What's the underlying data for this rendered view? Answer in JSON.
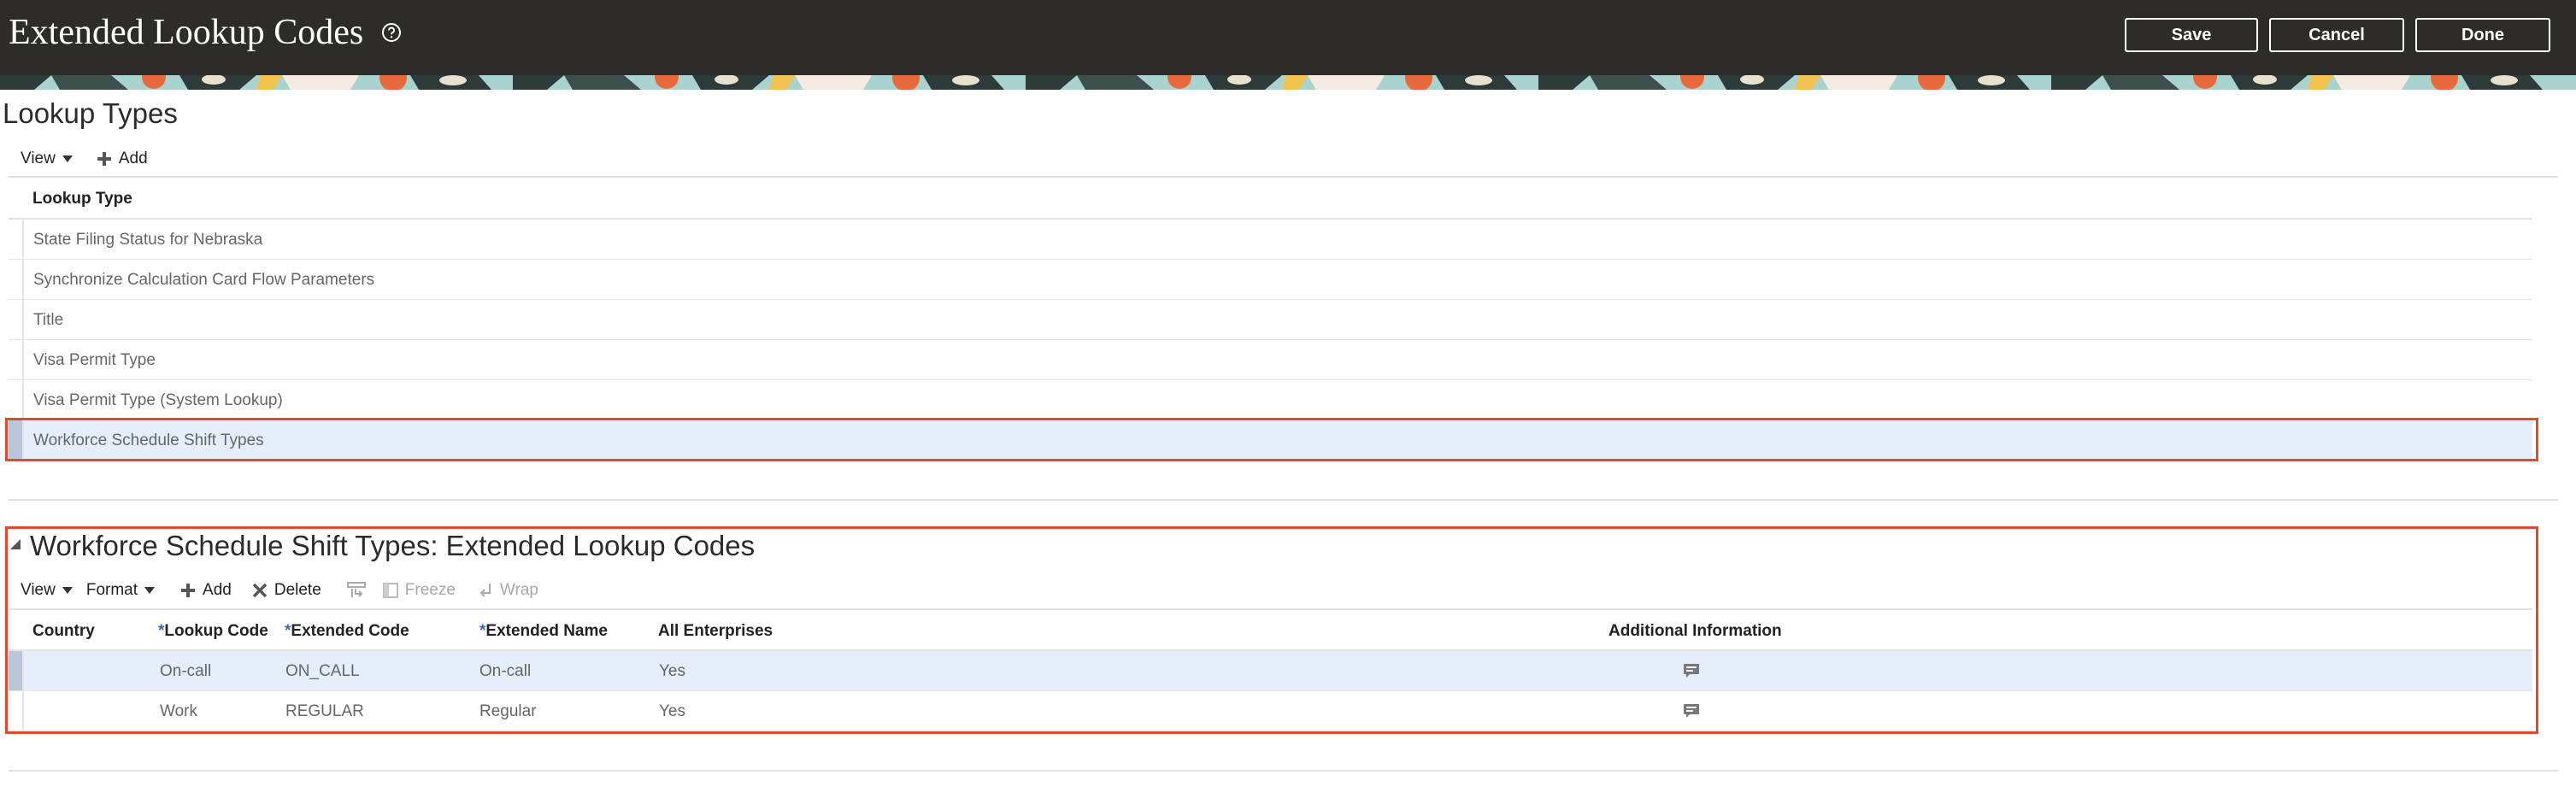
{
  "header": {
    "title": "Extended Lookup Codes",
    "save_label": "Save",
    "cancel_label": "Cancel",
    "done_label": "Done"
  },
  "lookup_types": {
    "title": "Lookup Types",
    "toolbar": {
      "view": "View",
      "add": "Add"
    },
    "column_header": "Lookup Type",
    "rows": [
      "State Filing Status for Nebraska",
      "Synchronize Calculation Card Flow Parameters",
      "Title",
      "Visa Permit Type",
      "Visa Permit Type (System Lookup)",
      "Workforce Schedule Shift Types"
    ],
    "selected_index": 5
  },
  "extended_codes": {
    "title": "Workforce Schedule Shift Types: Extended Lookup Codes",
    "toolbar": {
      "view": "View",
      "format": "Format",
      "add": "Add",
      "delete": "Delete",
      "freeze": "Freeze",
      "wrap": "Wrap"
    },
    "required_marker": "*",
    "columns": {
      "country": "Country",
      "lookup_code": "Lookup Code",
      "extended_code": "Extended Code",
      "extended_name": "Extended Name",
      "all_enterprises": "All Enterprises",
      "additional_information": "Additional Information"
    },
    "rows": [
      {
        "country": "",
        "lookup_code": "On-call",
        "extended_code": "ON_CALL",
        "extended_name": "On-call",
        "all_enterprises": "Yes",
        "info_icon": "comment-icon"
      },
      {
        "country": "",
        "lookup_code": "Work",
        "extended_code": "REGULAR",
        "extended_name": "Regular",
        "all_enterprises": "Yes",
        "info_icon": "comment-icon"
      }
    ],
    "selected_index": 0
  },
  "colors": {
    "header_bg": "#2f2b28",
    "highlight_border": "#e04a2f",
    "selected_row_bg": "#e5eefb",
    "required_asterisk": "#2f6cc0"
  }
}
